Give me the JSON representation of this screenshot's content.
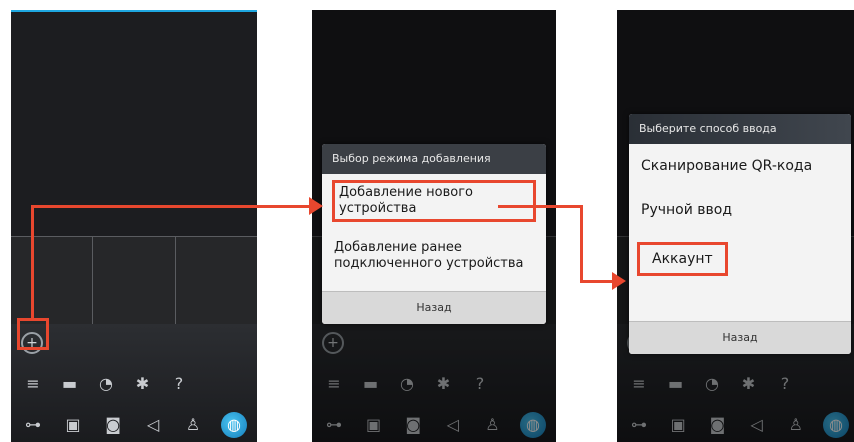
{
  "phone1": {
    "add_icon": "+",
    "icons_row1": [
      "trash-icon",
      "folder-icon",
      "timer-icon",
      "gear-icon",
      "help-icon"
    ],
    "icons_row1_glyphs": [
      "≡",
      "▬",
      "◔",
      "✱",
      "?"
    ],
    "icons_row2": [
      "key-icon",
      "image-icon",
      "camera-icon",
      "speaker-icon",
      "mic-icon",
      "globe-icon"
    ],
    "icons_row2_glyphs": [
      "⊶",
      "▣",
      "◙",
      "◁",
      "♙",
      "◍"
    ]
  },
  "phone2": {
    "dialog_title": "Выбор режима добавления",
    "option1": "Добавление нового устройства",
    "option2": "Добавление ранее подключенного устройства",
    "cancel": "Назад"
  },
  "phone3": {
    "dialog_title": "Выберите способ ввода",
    "option1": "Сканирование QR-кода",
    "option2": "Ручной ввод",
    "option3": "Аккаунт",
    "cancel": "Назад"
  },
  "colors": {
    "accent": "#e8472e",
    "highlight_blue": "#1ea7e0"
  }
}
